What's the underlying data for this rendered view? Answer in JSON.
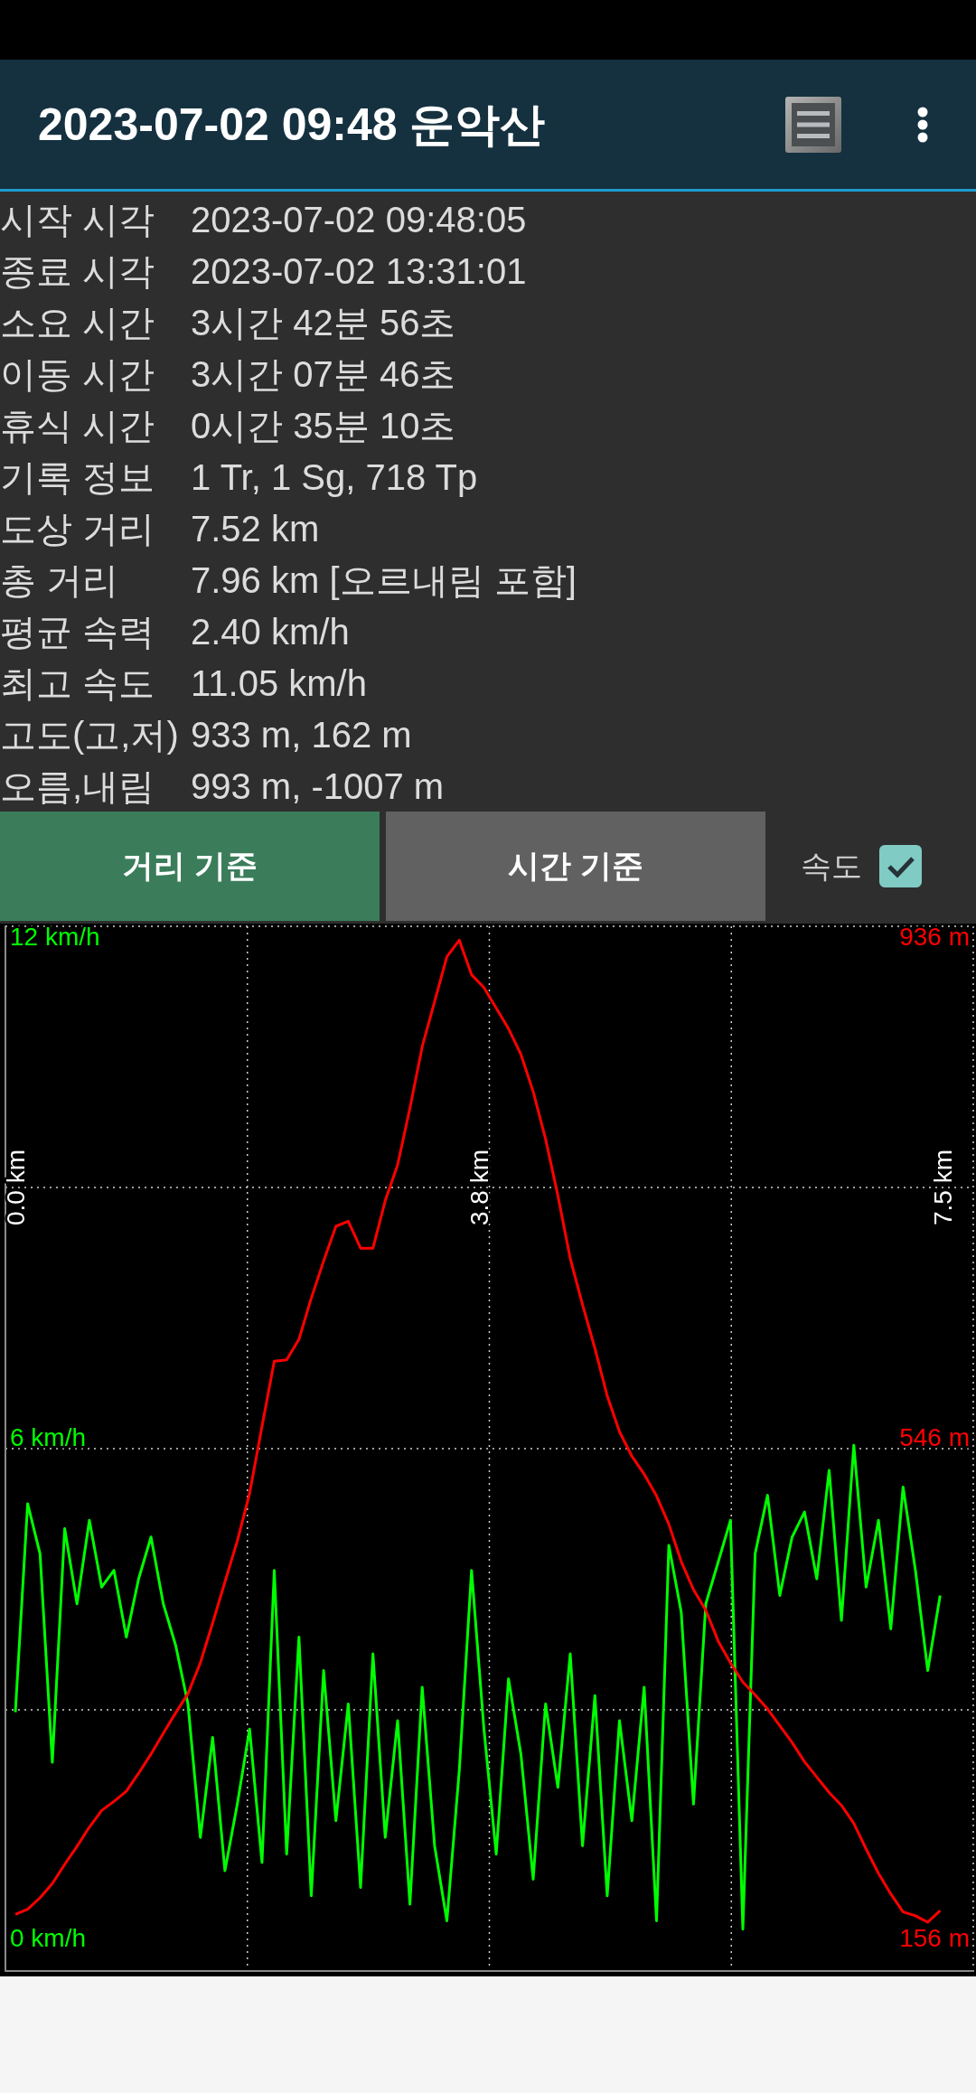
{
  "app_bar": {
    "title": "2023-07-02 09:48 운악산"
  },
  "stats": [
    {
      "label": "시작 시각",
      "value": "2023-07-02 09:48:05"
    },
    {
      "label": "종료 시각",
      "value": "2023-07-02 13:31:01"
    },
    {
      "label": "소요 시간",
      "value": "3시간 42분 56초"
    },
    {
      "label": "이동 시간",
      "value": "3시간 07분 46초"
    },
    {
      "label": "휴식 시간",
      "value": "0시간 35분 10초"
    },
    {
      "label": "기록 정보",
      "value": "1 Tr, 1 Sg, 718 Tp"
    },
    {
      "label": "도상 거리",
      "value": "7.52 km"
    },
    {
      "label": "총 거리",
      "value": "7.96 km [오르내림 포함]"
    },
    {
      "label": "평균 속력",
      "value": "2.40 km/h"
    },
    {
      "label": "최고 속도",
      "value": "11.05 km/h"
    },
    {
      "label": "고도(고,저)",
      "value": "933 m, 162 m"
    },
    {
      "label": "오름,내림",
      "value": "993 m, -1007 m"
    }
  ],
  "tabs": [
    {
      "label": "거리 기준",
      "selected": true
    },
    {
      "label": "시간 기준",
      "selected": false
    }
  ],
  "speed_toggle": {
    "label": "속도",
    "checked": true
  },
  "chart": {
    "chart_data": {
      "type": "line",
      "x": [
        0,
        0.1,
        0.2,
        0.3,
        0.4,
        0.5,
        0.6,
        0.7,
        0.8,
        0.9,
        1,
        1.1,
        1.2,
        1.3,
        1.4,
        1.5,
        1.6,
        1.7,
        1.8,
        1.9,
        2,
        2.1,
        2.2,
        2.3,
        2.4,
        2.5,
        2.6,
        2.7,
        2.8,
        2.9,
        3,
        3.1,
        3.2,
        3.3,
        3.4,
        3.5,
        3.6,
        3.7,
        3.8,
        3.9,
        4,
        4.1,
        4.2,
        4.3,
        4.4,
        4.5,
        4.6,
        4.7,
        4.8,
        4.9,
        5,
        5.1,
        5.2,
        5.3,
        5.4,
        5.5,
        5.6,
        5.7,
        5.8,
        5.9,
        6,
        6.1,
        6.2,
        6.3,
        6.4,
        6.5,
        6.6,
        6.7,
        6.8,
        6.9,
        7,
        7.1,
        7.2,
        7.3,
        7.4,
        7.5
      ],
      "xlim": [
        0,
        7.52
      ],
      "xticks": [
        {
          "value": 0,
          "label": "0.0 km"
        },
        {
          "value": 3.76,
          "label": "3.8 km"
        },
        {
          "value": 7.52,
          "label": "7.5 km"
        }
      ],
      "ylim": [
        0,
        12
      ],
      "yticks": [
        {
          "value": 0,
          "label": "0 km/h"
        },
        {
          "value": 6,
          "label": "6 km/h"
        },
        {
          "value": 12,
          "label": "12 km/h"
        }
      ],
      "y2lim": [
        156,
        936
      ],
      "y2ticks": [
        {
          "value": 156,
          "label": "156 m"
        },
        {
          "value": 546,
          "label": "546 m"
        },
        {
          "value": 936,
          "label": "936 m"
        }
      ],
      "series": [
        {
          "color": "#00ff00",
          "axis": "y",
          "values": [
            2.7,
            5.2,
            4.6,
            2.1,
            4.9,
            4.0,
            5.0,
            4.2,
            4.4,
            3.6,
            4.3,
            4.8,
            4.0,
            3.5,
            2.8,
            1.2,
            2.4,
            0.8,
            1.6,
            2.5,
            0.9,
            4.4,
            1.0,
            3.6,
            0.5,
            3.2,
            1.4,
            2.8,
            0.6,
            3.4,
            1.2,
            2.6,
            0.4,
            3.0,
            1.1,
            0.2,
            2.0,
            4.4,
            2.5,
            1.0,
            3.1,
            2.2,
            0.7,
            2.8,
            1.8,
            3.4,
            1.1,
            2.9,
            0.5,
            2.6,
            1.4,
            3.0,
            0.2,
            4.7,
            3.9,
            1.6,
            4.0,
            4.5,
            5.0,
            0.1,
            4.6,
            5.3,
            4.1,
            4.8,
            5.1,
            4.3,
            5.6,
            3.8,
            5.9,
            4.2,
            5.0,
            3.7,
            5.4,
            4.4,
            3.2,
            4.1
          ]
        },
        {
          "color": "#ff0000",
          "axis": "y2",
          "values": [
            174,
            178,
            187,
            198,
            213,
            227,
            242,
            255,
            262,
            270,
            284,
            299,
            315,
            331,
            346,
            370,
            401,
            433,
            465,
            502,
            554,
            605,
            606,
            622,
            654,
            683,
            710,
            714,
            693,
            693,
            730,
            758,
            802,
            850,
            885,
            920,
            933,
            906,
            896,
            880,
            864,
            844,
            815,
            778,
            734,
            685,
            649,
            615,
            578,
            550,
            531,
            517,
            500,
            478,
            449,
            427,
            411,
            387,
            370,
            355,
            345,
            334,
            321,
            308,
            293,
            281,
            269,
            259,
            245,
            225,
            206,
            190,
            176,
            173,
            168,
            177
          ]
        }
      ]
    }
  }
}
